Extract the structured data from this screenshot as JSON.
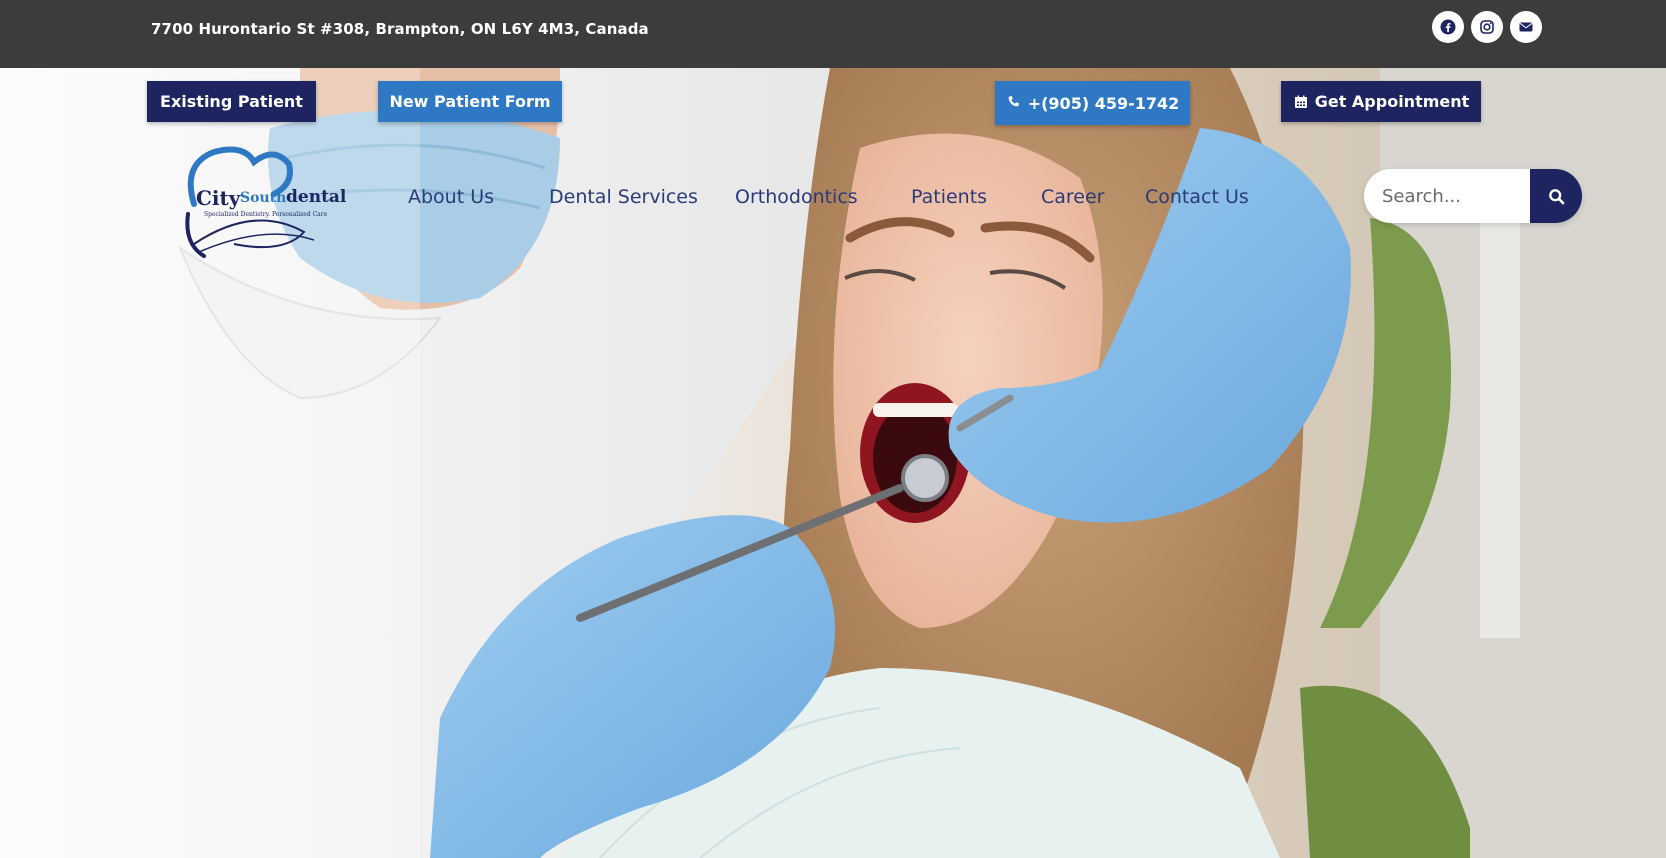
{
  "topbar": {
    "address": "7700 Hurontario St #308, Brampton, ON L6Y 4M3, Canada",
    "social_icons": [
      "facebook-icon",
      "instagram-icon",
      "envelope-icon"
    ]
  },
  "buttons": {
    "existing_patient": "Existing Patient",
    "new_patient_form": "New Patient Form",
    "phone": "+(905) 459-1742",
    "appointment": "Get Appointment"
  },
  "logo": {
    "city": "City",
    "south": "South",
    "dental": "dental",
    "tagline": "Specialized Dentistry. Personalized Care"
  },
  "nav": {
    "items": [
      "About Us",
      "Dental Services",
      "Orthodontics",
      "Patients",
      "Career",
      "Contact Us"
    ]
  },
  "search": {
    "placeholder": "Search..."
  },
  "colors": {
    "topbar_bg": "#3b3c3b",
    "navy": "#1d2460",
    "blue": "#2f79c4",
    "nav_text": "#2b3a78"
  }
}
